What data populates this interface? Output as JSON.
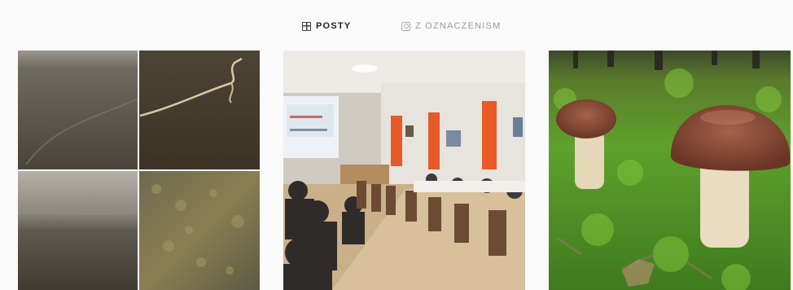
{
  "tabs": {
    "posts_label": "POSTY",
    "posts_icon": "grid-icon",
    "tagged_label": "Z OZNACZENISM",
    "tagged_icon": "tagged-icon",
    "active": "POSTY"
  },
  "posts": [
    {
      "subject": "aerial-collage"
    },
    {
      "subject": "conference-room"
    },
    {
      "subject": "mushrooms"
    }
  ]
}
